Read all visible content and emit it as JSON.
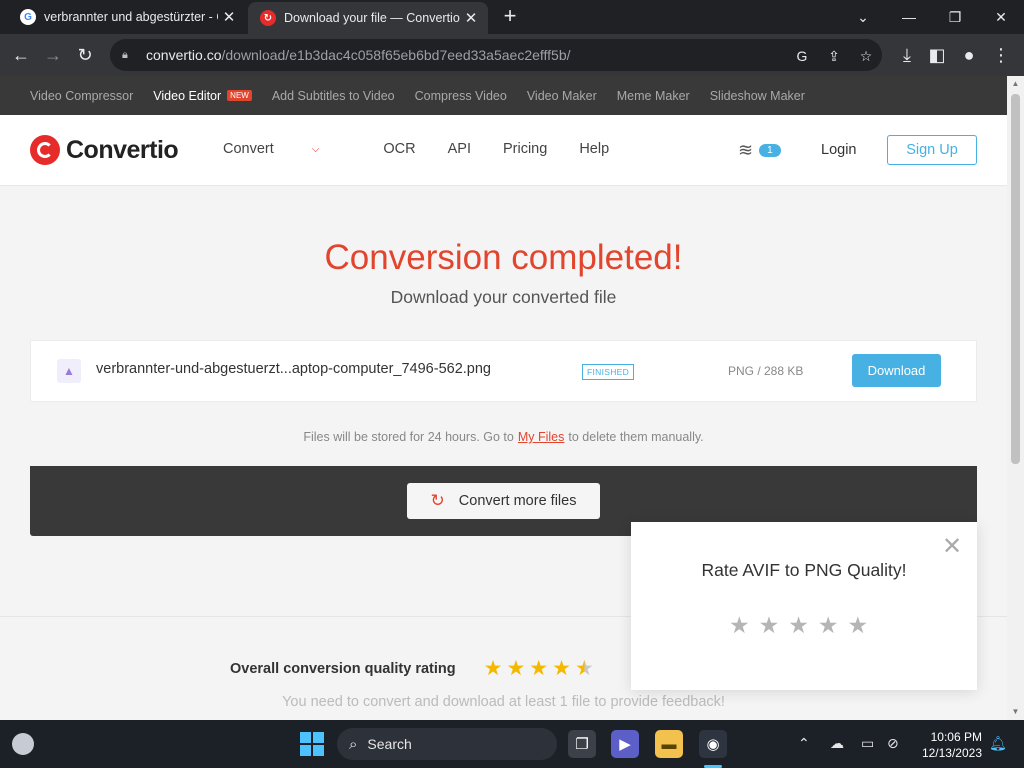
{
  "browser": {
    "tabs": [
      {
        "title": "verbrannter und abgestürzter - G"
      },
      {
        "title": "Download your file — Convertio"
      }
    ],
    "url_host": "convertio.co",
    "url_path": "/download/e1b3dac4c058f65eb6bd7eed33a5aec2efff5b/"
  },
  "promo": {
    "items": [
      "Video Compressor",
      "Video Editor",
      "Add Subtitles to Video",
      "Compress Video",
      "Video Maker",
      "Meme Maker",
      "Slideshow Maker"
    ],
    "new_badge": "NEW"
  },
  "header": {
    "logo": "Convertio",
    "nav": [
      "Convert",
      "OCR",
      "API",
      "Pricing",
      "Help"
    ],
    "files_count": "1",
    "login": "Login",
    "signup": "Sign Up"
  },
  "main": {
    "title": "Conversion completed!",
    "subtitle": "Download your converted file",
    "file": {
      "name": "verbrannter-und-abgestuerzt...aptop-computer_7496-562.png",
      "status": "FINISHED",
      "meta": "PNG / 288 KB",
      "download_label": "Download"
    },
    "storage_before": "Files will be stored for 24 hours. Go to",
    "storage_link": "My Files",
    "storage_after": "to delete them manually.",
    "convert_more": "Convert more files"
  },
  "rating": {
    "label": "Overall conversion quality rating",
    "value": 4.5,
    "max": 5,
    "feedback": "You need to convert and download at least 1 file to provide feedback!"
  },
  "popup": {
    "title": "Rate AVIF to PNG Quality!",
    "stars": 5
  },
  "taskbar": {
    "search": "Search",
    "time": "10:06 PM",
    "date": "12/13/2023"
  },
  "colors": {
    "brand_red": "#e2452e",
    "accent_blue": "#47b1e4",
    "star_gold": "#f5b800"
  }
}
